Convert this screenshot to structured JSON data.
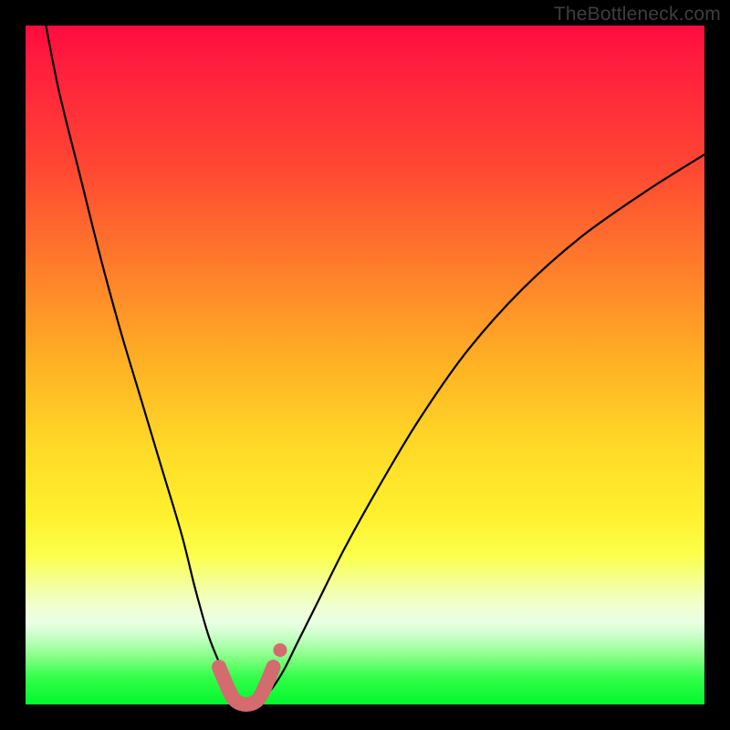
{
  "watermark": "TheBottleneck.com",
  "chart_data": {
    "type": "line",
    "title": "",
    "xlabel": "",
    "ylabel": "",
    "xlim": [
      0,
      100
    ],
    "ylim": [
      0,
      100
    ],
    "grid": false,
    "series": [
      {
        "name": "bottleneck-curve",
        "color": "#000000",
        "x": [
          3,
          5,
          8,
          11,
          14,
          17,
          20,
          23,
          25,
          27,
          29,
          30,
          31,
          32.5,
          34,
          36,
          38,
          40,
          43,
          47,
          52,
          58,
          65,
          73,
          82,
          92,
          100
        ],
        "values": [
          100,
          90,
          78,
          66,
          55,
          45,
          35,
          25,
          17,
          10,
          5,
          2,
          0.5,
          0,
          0.5,
          2,
          5,
          9,
          15,
          23,
          32,
          42,
          52,
          61,
          69,
          76,
          81
        ]
      },
      {
        "name": "valley-highlight",
        "color": "#d36b6f",
        "x": [
          28.5,
          30,
          31,
          32.5,
          34,
          35,
          36.5
        ],
        "values": [
          5.5,
          2,
          0.5,
          0,
          0.5,
          2,
          5.5
        ]
      }
    ],
    "annotations": [
      {
        "name": "highlight-end-dot",
        "x": 37.5,
        "y": 8,
        "color": "#d36b6f"
      }
    ]
  }
}
